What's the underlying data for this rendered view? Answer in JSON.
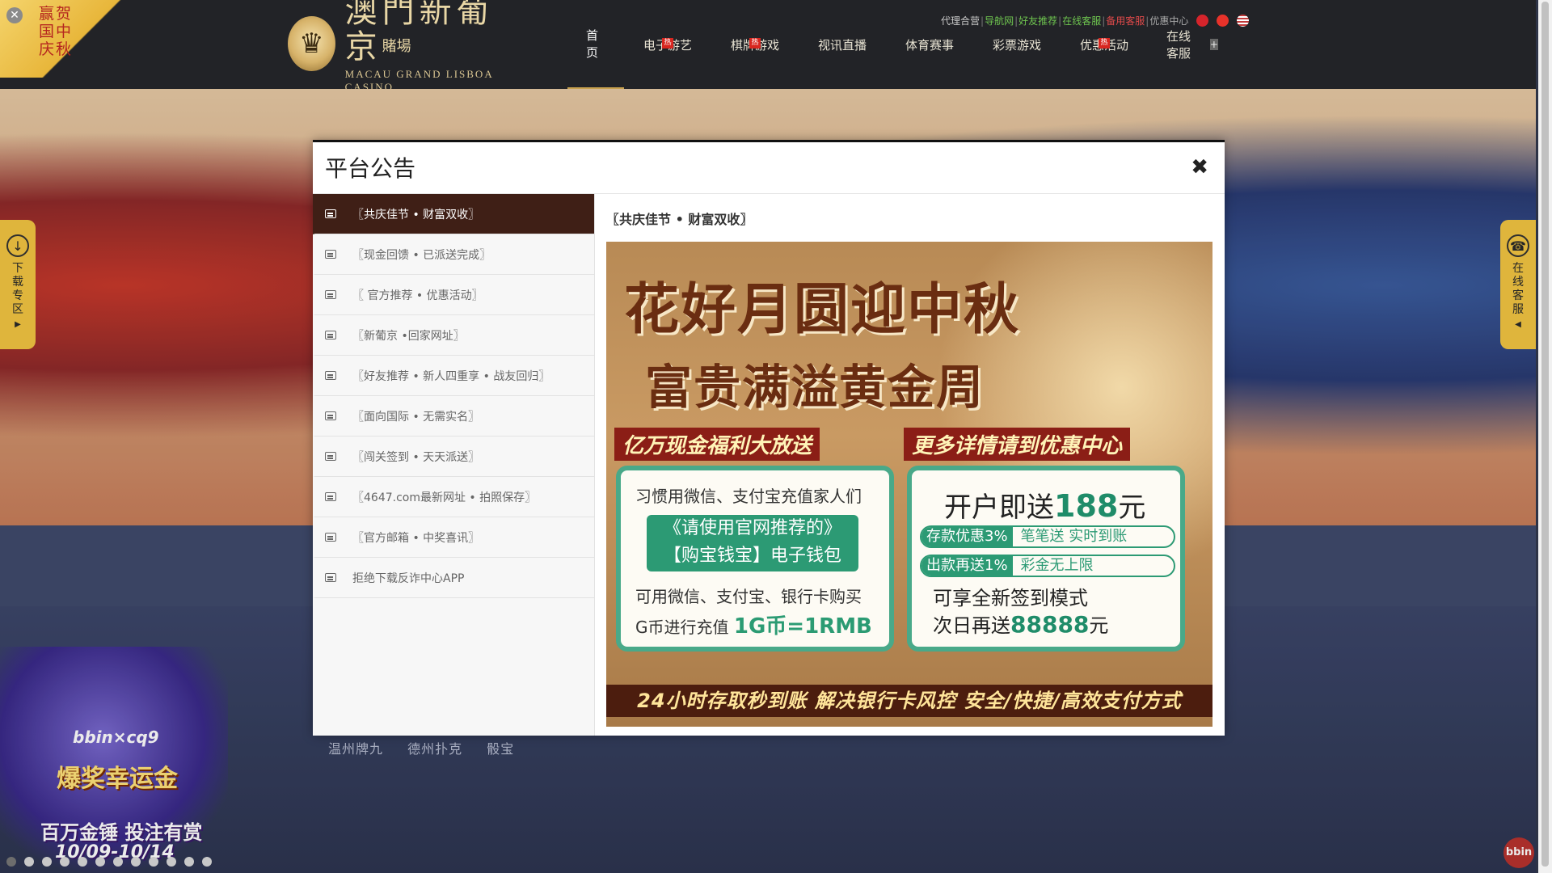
{
  "corner": {
    "text": "赢贺\n国中\n庆秋",
    "close_icon": "close-icon"
  },
  "logo": {
    "zh": "澳門新葡京",
    "zh_small": "賭場",
    "en": "MACAU GRAND LISBOA CASINO"
  },
  "toplinks": {
    "agent": "代理合营",
    "nav_site": "导航网",
    "friend": "好友推荐",
    "service": "在线客服",
    "backup": "备用客服",
    "promo_center": "优惠中心"
  },
  "nav": {
    "home": "首页",
    "egames": "电子游艺",
    "cards": "棋牌游戏",
    "live": "视讯直播",
    "sports": "体育赛事",
    "lottery": "彩票游戏",
    "promos": "优惠活动",
    "support": "在线客服",
    "hot_label": "热"
  },
  "side": {
    "left_label": "下载专区",
    "right_label": "在线客服"
  },
  "games": [
    "温州牌九",
    "德州扑克",
    "骰宝"
  ],
  "promo_card": {
    "brand": "bbin×cq9",
    "line1": "爆奖幸运金",
    "line2": "百万金锤 投注有赏",
    "line3": "10/09-10/14"
  },
  "bbin_label": "bbin",
  "modal": {
    "title": "平台公告",
    "close": "✖",
    "items": [
      "〖共庆佳节 • 财富双收〗",
      "〖现金回馈 • 已派送完成〗",
      "〖 官方推荐 • 优惠活动〗",
      "〖新葡京 •回家网址〗",
      "〖好友推荐 • 新人四重享 • 战友回归〗",
      "〖面向国际 • 无需实名〗",
      "〖闯关签到 • 天天派送〗",
      "〖4647.com最新网址 • 拍照保存〗",
      "〖官方邮箱 • 中奖喜讯〗",
      "拒绝下载反诈中心APP"
    ],
    "content_title": "〖共庆佳节 • 财富双收〗",
    "promo": {
      "h1": "花好月圆迎中秋",
      "h2": "富贵满溢黄金周",
      "ribbon1": "亿万现金福利大放送",
      "ribbon2": "更多详情请到优惠中心",
      "left_l1": "习惯用微信、支付宝充值家人们",
      "left_box1": "《请使用官网推荐的》",
      "left_box2": "【购宝钱宝】电子钱包",
      "left_l2": "可用微信、支付宝、银行卡购买",
      "left_l3a": "G币进行充值",
      "left_l3b": "1G币=1RMB",
      "right_open_a": "开户即送",
      "right_open_b": "188",
      "right_open_c": "元",
      "pill1a": "存款优惠3%",
      "pill1b": "笔笔送 实时到账",
      "pill2a": "出款再送1%",
      "pill2b": "彩金无上限",
      "right_l1": "可享全新签到模式",
      "right_l2a": "次日再送",
      "right_l2b": "88888",
      "right_l2c": "元",
      "bottom": "24小时存取秒到账  解决银行卡风控  安全/快捷/高效支付方式"
    }
  }
}
